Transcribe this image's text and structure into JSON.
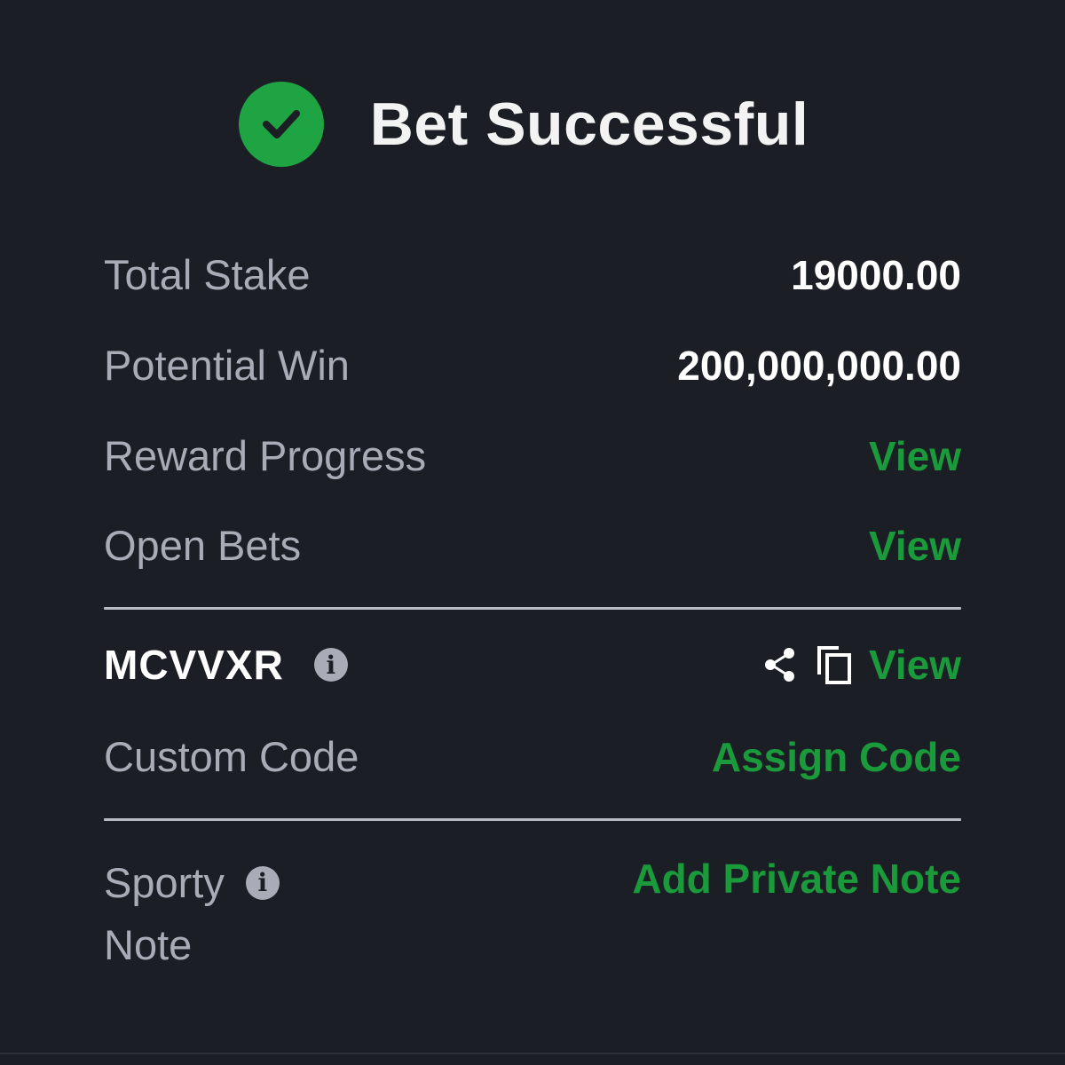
{
  "header": {
    "title": "Bet Successful",
    "icon": "check-circle-icon",
    "accent_color": "#1fa443"
  },
  "summary": {
    "total_stake_label": "Total Stake",
    "total_stake_value": "19000.00",
    "potential_win_label": "Potential Win",
    "potential_win_value": "200,000,000.00",
    "reward_progress_label": "Reward Progress",
    "reward_progress_link": "View",
    "open_bets_label": "Open Bets",
    "open_bets_link": "View"
  },
  "booking": {
    "code": "MCVVXR",
    "info_icon": "info-icon",
    "share_icon": "share-icon",
    "copy_icon": "copy-icon",
    "view_link": "View",
    "custom_code_label": "Custom Code",
    "assign_code_link": "Assign Code"
  },
  "note": {
    "label_line1": "Sporty",
    "label_line2": "Note",
    "add_note_link": "Add Private Note"
  },
  "colors": {
    "background": "#1b1e25",
    "link_green": "#1a9a3a",
    "label_gray": "#a9acb6"
  }
}
